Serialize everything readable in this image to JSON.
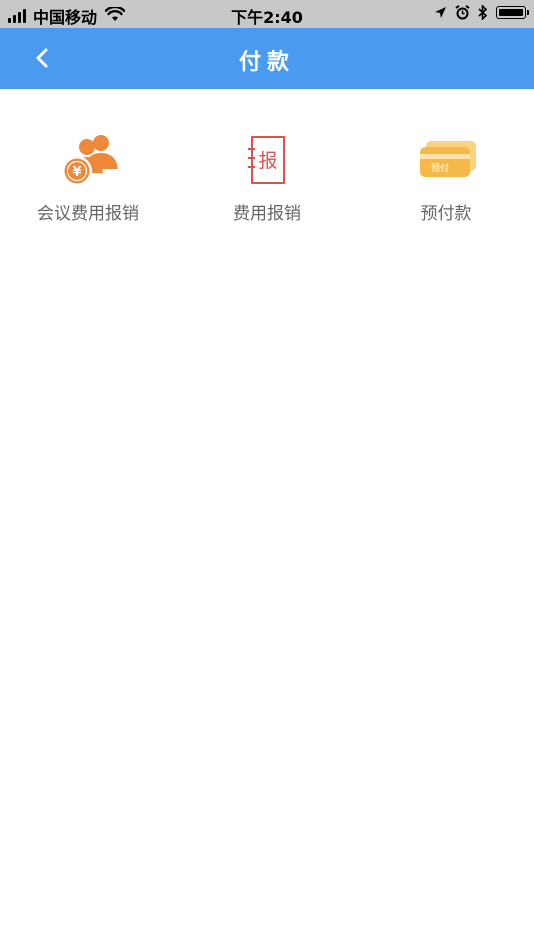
{
  "status_bar": {
    "carrier": "中国移动",
    "time": "下午2:40",
    "icons": [
      "signal-bars-icon",
      "wifi-icon",
      "location-arrow-icon",
      "alarm-clock-icon",
      "bluetooth-icon",
      "battery-icon"
    ]
  },
  "nav": {
    "title": "付款",
    "back_icon": "chevron-left-icon",
    "background": "#4a9bf0"
  },
  "menu": {
    "items": [
      {
        "label": "会议费用报销",
        "icon": "meeting-expense-icon",
        "icon_color": "#f0883a"
      },
      {
        "label": "费用报销",
        "icon": "expense-report-icon",
        "icon_color": "#d9534f",
        "icon_text": "报"
      },
      {
        "label": "预付款",
        "icon": "prepayment-card-icon",
        "icon_color": "#f5b94a",
        "icon_text": "预付"
      }
    ]
  }
}
